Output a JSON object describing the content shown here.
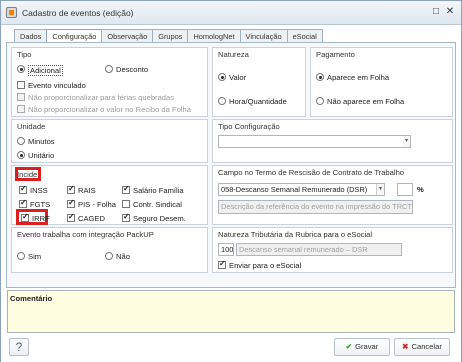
{
  "window": {
    "title": "Cadastro de eventos (edição)",
    "restore_glyph": "□",
    "close_glyph": "✕"
  },
  "tabs": [
    "Dados",
    "Configuração",
    "Observação",
    "Grupos",
    "HomologNet",
    "Vinculação",
    "eSocial"
  ],
  "tipo": {
    "title": "Tipo",
    "options": [
      "Adicional",
      "Desconto"
    ],
    "selected": "Adicional",
    "checks": [
      {
        "label": "Evento vinculado",
        "enabled": true,
        "checked": false
      },
      {
        "label": "Não proporcionalizar para férias quebradas",
        "enabled": false,
        "checked": false
      },
      {
        "label": "Não proporcionalizar o valor no Recibo da Folha",
        "enabled": false,
        "checked": false
      }
    ]
  },
  "natureza": {
    "title": "Natureza",
    "options": [
      "Valor",
      "Hora/Quantidade"
    ],
    "selected": "Valor"
  },
  "pagamento": {
    "title": "Pagamento",
    "options": [
      "Aparece em Folha",
      "Não aparece em Folha"
    ],
    "selected": "Aparece em Folha"
  },
  "unidade": {
    "title": "Unidade",
    "options": [
      "Minutos",
      "Unitário"
    ],
    "selected": "Unitário"
  },
  "tipo_config": {
    "title": "Tipo Configuração",
    "value": ""
  },
  "incide": {
    "title": "Incide",
    "items": [
      {
        "label": "INSS",
        "checked": true
      },
      {
        "label": "RAIS",
        "checked": true
      },
      {
        "label": "Salário Família",
        "checked": true
      },
      {
        "label": "FGTS",
        "checked": true
      },
      {
        "label": "PIS - Folha",
        "checked": true
      },
      {
        "label": "Contr. Sindical",
        "checked": false
      },
      {
        "label": "IRRF",
        "checked": true
      },
      {
        "label": "CAGED",
        "checked": true
      },
      {
        "label": "Seguro Desem.",
        "checked": true
      }
    ]
  },
  "trct": {
    "title": "Campo no Termo de Rescisão de Contrato de Trabalho",
    "selected": "058-Descanso Semanal Remunerado (DSR)",
    "percent": "",
    "percent_label": "%",
    "description_placeholder": "Descrição da referência do evento na impressão do TRCT"
  },
  "packup": {
    "title": "Evento trabalha com integração PackUP",
    "options": [
      "Sim",
      "Não"
    ],
    "selected": null
  },
  "natureza_esocial": {
    "title": "Natureza Tributária da Rubrica para o eSocial",
    "code": "1002",
    "description": "Descanso semanal remunerado – DSR",
    "enviar_label": "Enviar para o eSocial",
    "enviar_checked": true
  },
  "comentario": {
    "label": "Comentário",
    "value": ""
  },
  "buttons": {
    "help": "?",
    "gravar": "Gravar",
    "cancelar": "Cancelar"
  },
  "colors": {
    "highlight": "#dc1f1f",
    "comment_bg": "#fffde0"
  }
}
